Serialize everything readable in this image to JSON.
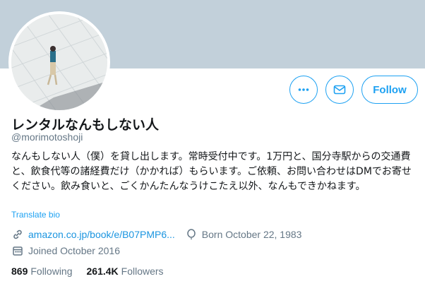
{
  "profile": {
    "display_name": "レンタルなんもしない人",
    "handle": "@morimotoshoji",
    "bio": "なんもしない人（僕）を貸し出します。常時受付中です。1万円と、国分寺駅からの交通費と、飲食代等の諸経費だけ（かかれば）もらいます。ご依頼、お問い合わせはDMでお寄せください。飲み食いと、ごくかんたんなうけこたえ以外、なんもできかねます。",
    "translate_label": "Translate bio",
    "website": "amazon.co.jp/book/e/B07PMP6...",
    "birthday": "Born October 22, 1983",
    "joined": "Joined October 2016"
  },
  "actions": {
    "more_icon": "more-icon",
    "message_icon": "envelope-icon",
    "follow_label": "Follow"
  },
  "stats": {
    "following_count": "869",
    "following_label": "Following",
    "followers_count": "261.4K",
    "followers_label": "Followers"
  },
  "colors": {
    "accent": "#1da1f2",
    "banner": "#c2d0da",
    "secondary_text": "#657786"
  }
}
